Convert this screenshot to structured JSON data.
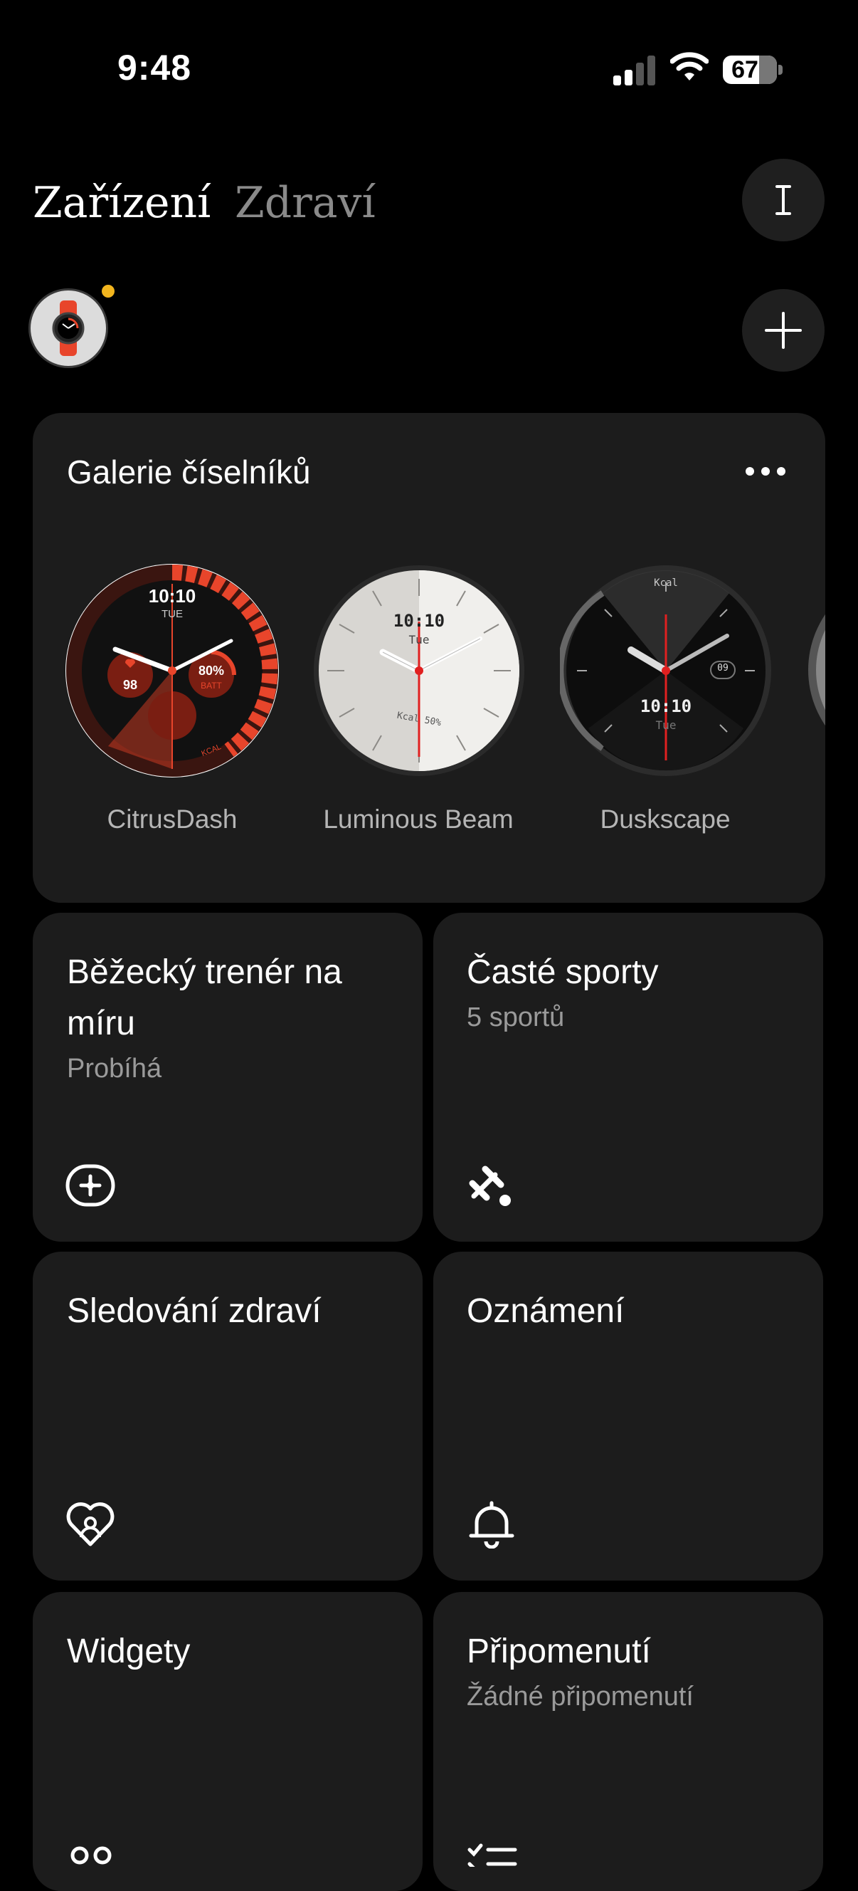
{
  "status_bar": {
    "time": "9:48",
    "battery": "67"
  },
  "header": {
    "tabs": [
      {
        "label": "Zařízení",
        "active": true
      },
      {
        "label": "Zdraví",
        "active": false
      }
    ],
    "menu_icon": "text-cursor-icon",
    "add_icon": "plus-icon"
  },
  "device": {
    "avatar": "watch-icon",
    "notification_color": "#f2b51e"
  },
  "gallery": {
    "title": "Galerie číselníků",
    "more_icon": "ellipsis-icon",
    "faces": [
      {
        "name": "CitrusDash",
        "time": "10:10",
        "day": "TUE",
        "stat1": "98",
        "stat2": "80%",
        "stat2_label": "BATT",
        "footer": "KCAL"
      },
      {
        "name": "Luminous Beam",
        "time": "10:10",
        "day": "Tue",
        "footer": "Kcal 50%"
      },
      {
        "name": "Duskscape",
        "time": "10:10",
        "day": "Tue",
        "top": "Kcal",
        "date": "09"
      }
    ]
  },
  "tiles": [
    {
      "title": "Běžecký trenér na míru",
      "subtitle": "Probíhá",
      "icon": "running-coach-icon"
    },
    {
      "title": "Časté sporty",
      "subtitle": "5  sportů",
      "icon": "dumbbell-icon"
    },
    {
      "title": "Sledování zdraví",
      "subtitle": "",
      "icon": "heart-person-icon"
    },
    {
      "title": "Oznámení",
      "subtitle": "",
      "icon": "bell-icon"
    },
    {
      "title": "Widgety",
      "subtitle": "",
      "icon": "widgets-icon"
    },
    {
      "title": "Připomenutí",
      "subtitle": "Žádné připomenutí",
      "icon": "checklist-icon"
    }
  ],
  "colors": {
    "accent": "#e8452b",
    "card": "#1c1c1c",
    "muted": "#9a9a9a"
  }
}
